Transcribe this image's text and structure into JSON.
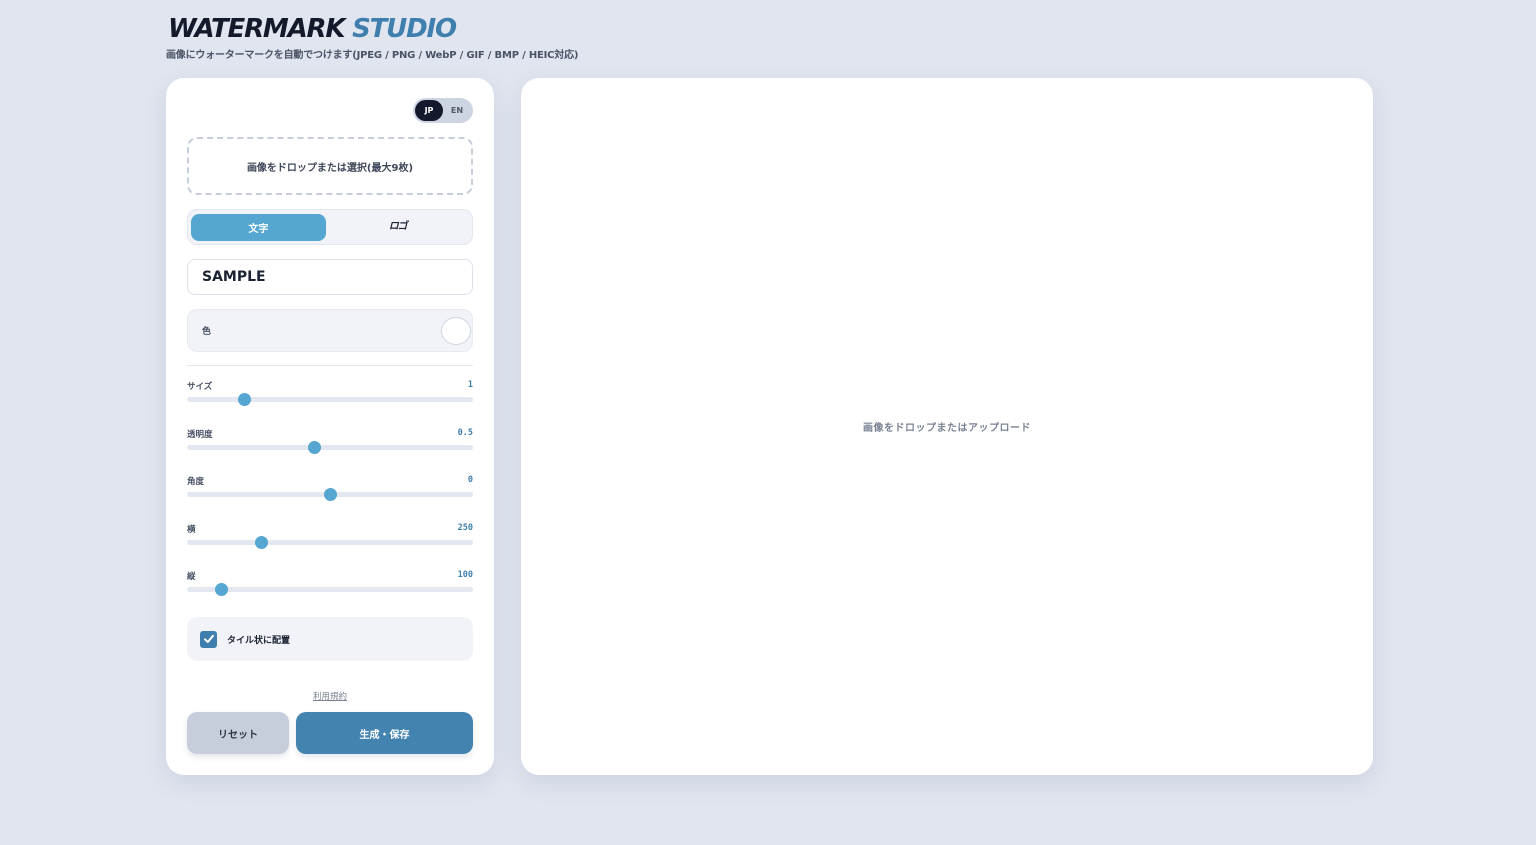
{
  "header": {
    "logo_part1": "WATERMARK",
    "logo_part2": "STUDIO",
    "subtitle": "画像にウォーターマークを自動でつけます(JPEG / PNG / WebP / GIF / BMP / HEIC対応)"
  },
  "language": {
    "jp_label": "JP",
    "en_label": "EN",
    "selected": "JP"
  },
  "dropzone": {
    "label": "画像をドロップまたは選択(最大9枚)"
  },
  "mode": {
    "text_label": "文字",
    "logo_label": "ロゴ",
    "selected": "文字"
  },
  "watermark_text": {
    "value": "SAMPLE"
  },
  "color": {
    "label": "色",
    "value": "#ffffff"
  },
  "sliders": [
    {
      "label": "サイズ",
      "value": "1",
      "fraction": 0.2
    },
    {
      "label": "透明度",
      "value": "0.5",
      "fraction": 0.447
    },
    {
      "label": "角度",
      "value": "0",
      "fraction": 0.5
    },
    {
      "label": "横",
      "value": "250",
      "fraction": 0.262
    },
    {
      "label": "縦",
      "value": "100",
      "fraction": 0.122
    }
  ],
  "tile": {
    "label": "タイル状に配置",
    "checked": true
  },
  "footer": {
    "terms_label": "利用規約",
    "reset_label": "リセット",
    "save_label": "生成・保存"
  },
  "preview": {
    "placeholder": "画像をドロップまたはアップロード"
  },
  "colors": {
    "accent": "#55a6d0",
    "primary": "#4283af",
    "dark": "#141a2b",
    "background": "#e1e5ef"
  }
}
